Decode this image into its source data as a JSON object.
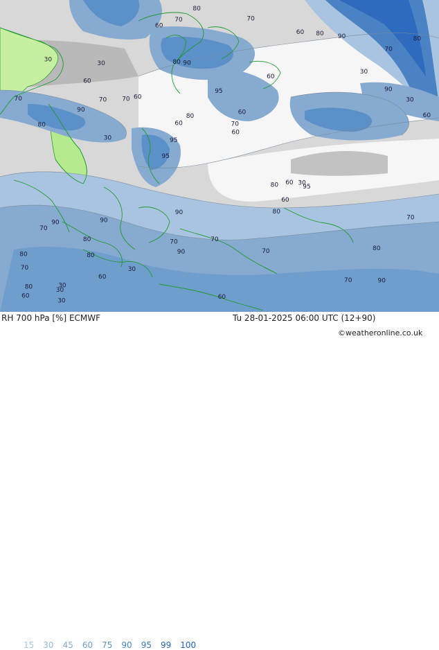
{
  "footer": {
    "title": "RH 700 hPa [%] ECMWF",
    "datetime": "Tu 28-01-2025 06:00 UTC (12+90)",
    "credit": "©weatheronline.co.uk"
  },
  "legend": [
    {
      "label": "15",
      "color": "#a9c4e0"
    },
    {
      "label": "30",
      "color": "#98b8d8"
    },
    {
      "label": "45",
      "color": "#86aad0"
    },
    {
      "label": "60",
      "color": "#6f9ecd"
    },
    {
      "label": "75",
      "color": "#5b90c8"
    },
    {
      "label": "90",
      "color": "#4a82c4"
    },
    {
      "label": "95",
      "color": "#3b76c0"
    },
    {
      "label": "99",
      "color": "#2e6abd"
    },
    {
      "label": "100",
      "color": "#245fb8"
    }
  ],
  "contour_labels": [
    "90",
    "80",
    "70",
    "95",
    "60",
    "30",
    "80",
    "95",
    "90",
    "60",
    "70",
    "80",
    "90",
    "60",
    "95",
    "30",
    "70",
    "60",
    "80",
    "90",
    "95",
    "70",
    "60",
    "30",
    "60",
    "90",
    "70",
    "80",
    "30",
    "60",
    "70",
    "90",
    "80",
    "60",
    "30",
    "70",
    "80",
    "90",
    "60",
    "70",
    "30",
    "80",
    "60",
    "70",
    "80",
    "30",
    "60",
    "70",
    "90",
    "80",
    "30",
    "70",
    "60",
    "80",
    "30",
    "70",
    "60",
    "80",
    "70",
    "90",
    "30",
    "60",
    "70",
    "80"
  ]
}
